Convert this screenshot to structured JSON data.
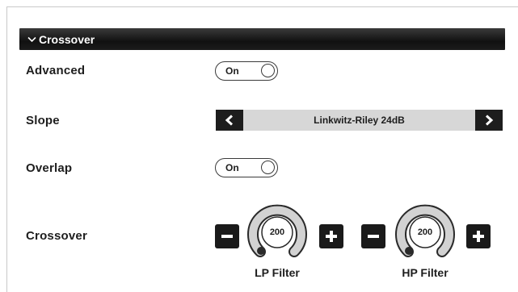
{
  "section": {
    "title": "Crossover",
    "toggle_icon": "chevron-down-icon"
  },
  "rows": {
    "advanced": {
      "label": "Advanced",
      "value": "On"
    },
    "slope": {
      "label": "Slope",
      "value": "Linkwitz-Riley 24dB",
      "prev_icon": "chevron-left-icon",
      "next_icon": "chevron-right-icon"
    },
    "overlap": {
      "label": "Overlap",
      "value": "On"
    },
    "crossover": {
      "label": "Crossover",
      "lp": {
        "label": "LP Filter",
        "value": "200"
      },
      "hp": {
        "label": "HP Filter",
        "value": "200"
      }
    }
  },
  "colors": {
    "header_bg": "#111111",
    "button_bg": "#1a1a1a",
    "slope_bg": "#d7d7d7",
    "knob_ring": "#cfcfcf"
  }
}
